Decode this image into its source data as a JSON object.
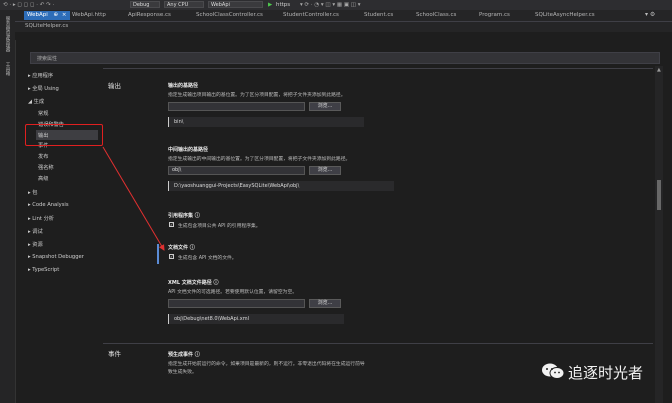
{
  "toolbar": {
    "config": "Debug",
    "platform": "Any CPU",
    "project": "WebApi",
    "run": "https"
  },
  "left_strip": [
    "服务器资源管理器",
    "工具箱"
  ],
  "tabs": [
    {
      "label": "WebApi",
      "active": true,
      "close": "×"
    },
    {
      "label": "WebApi.http"
    },
    {
      "label": "ApiResponse.cs"
    },
    {
      "label": "SchoolClassController.cs"
    },
    {
      "label": "StudentController.cs"
    },
    {
      "label": "Student.cs"
    },
    {
      "label": "SchoolClass.cs"
    },
    {
      "label": "Program.cs"
    },
    {
      "label": "SQLiteAsyncHelper.cs"
    }
  ],
  "subtab": "SQLiteHelper.cs",
  "search": {
    "placeholder": "搜索属性"
  },
  "nav": {
    "app": "应用程序",
    "global_usings": "全局 Using",
    "build": "生成",
    "build_children": [
      "常规",
      "错误和警告",
      "输出",
      "事件",
      "发布",
      "强名称",
      "高级"
    ],
    "package": "包",
    "code_analysis": "Code Analysis",
    "lint": "Lint 分析",
    "debug": "调试",
    "resources": "资源",
    "snapshot": "Snapshot Debugger",
    "typescript": "TypeScript"
  },
  "output_section": {
    "title": "输出",
    "base_path": {
      "label": "输出的基路径",
      "desc": "指定生成输出项目输出的基位置。为了区分项目配置，将把子文件夹添加到此路径。",
      "browse": "浏览...",
      "value": "bin\\"
    },
    "intermediate": {
      "label": "中间输出的基路径",
      "desc": "指定生成输出的中间输出的基位置。为了区分项目配置，将把子文件夹添加到此路径。",
      "value": "obj\\",
      "browse": "浏览...",
      "resolved": "D:\\yaoshuanggui-Projects\\EasySQLite\\WebApi\\obj\\"
    },
    "ref_assembly": {
      "label": "引用程序集",
      "check": "生成包含项目公共 API 的引用程序集。"
    },
    "doc_file": {
      "label": "文档文件",
      "check": "生成包含 API 文档的文件。"
    },
    "xml_doc": {
      "label": "XML 文档文件路径",
      "desc": "API 文档文件的可选路径。若要使用默认位置，请留空为空。",
      "browse": "浏览...",
      "value": "obj\\Debug\\net8.0\\WebApi.xml"
    }
  },
  "events_section": {
    "title": "事件",
    "pre_build": {
      "label": "预生成事件",
      "desc1": "指定生成开始前运行的命令。如果项目是最新的，则不运行。非零退出代码将在生成运行前导",
      "desc2": "致生成失败。"
    }
  },
  "watermark": "追逐时光者",
  "colors": {
    "accent": "#2d6db8",
    "highlight_box": "#e02020",
    "arrow": "#e03030"
  }
}
